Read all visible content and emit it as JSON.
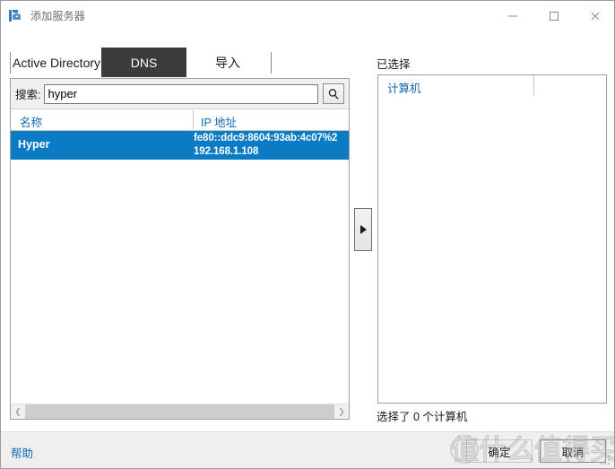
{
  "window": {
    "title": "添加服务器",
    "icon": "server-add-icon",
    "controls": {
      "minimize": "minimize-icon",
      "maximize": "maximize-icon",
      "close": "close-icon"
    }
  },
  "tabs": [
    {
      "label": "Active Directory",
      "active": false
    },
    {
      "label": "DNS",
      "active": true
    },
    {
      "label": "导入",
      "active": false
    }
  ],
  "search": {
    "label": "搜索:",
    "value": "hyper",
    "placeholder": "",
    "button_icon": "search-icon"
  },
  "left_list": {
    "columns": [
      "名称",
      "IP 地址"
    ],
    "rows": [
      {
        "name": "Hyper",
        "ip_lines": [
          "fe80::ddc9:8604:93ab:4c07%2",
          "192.168.1.108"
        ],
        "selected": true
      }
    ],
    "scrollbar": {
      "left_arrow": "chevron-left-icon",
      "right_arrow": "chevron-right-icon"
    }
  },
  "move_button": {
    "icon": "triangle-right-icon",
    "label": ""
  },
  "right_panel": {
    "label": "已选择",
    "columns": [
      "计算机"
    ],
    "rows": [],
    "status": "选择了 0 个计算机"
  },
  "footer": {
    "help": "帮助",
    "ok": "确定",
    "cancel": "取消"
  },
  "watermark": {
    "text": "值什么值得买"
  },
  "colors": {
    "accent": "#0b7cc4",
    "link": "#1169b0",
    "active_tab_bg": "#3b3b3b",
    "footer_bg": "#efefef",
    "border": "#a0a0a0"
  }
}
